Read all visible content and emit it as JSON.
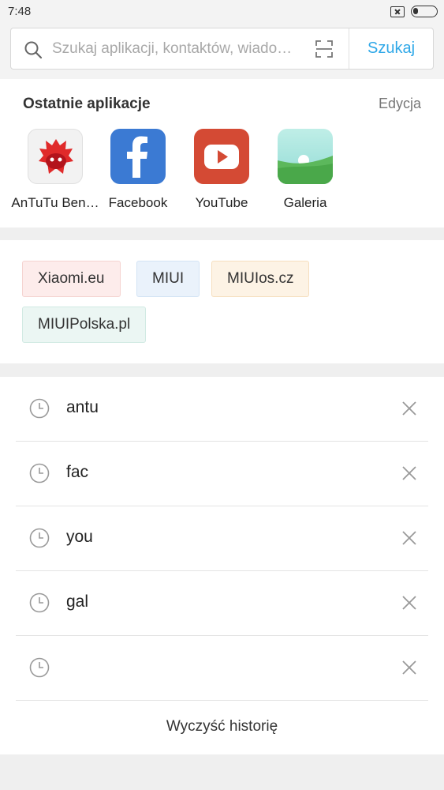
{
  "status_bar": {
    "time": "7:48"
  },
  "search": {
    "placeholder": "Szukaj aplikacji, kontaktów, wiado…",
    "button_label": "Szukaj"
  },
  "recent_apps": {
    "title": "Ostatnie aplikacje",
    "edit_label": "Edycja",
    "apps": [
      {
        "label": "AnTuTu Ben…",
        "icon": "antutu-icon"
      },
      {
        "label": "Facebook",
        "icon": "facebook-icon"
      },
      {
        "label": "YouTube",
        "icon": "youtube-icon"
      },
      {
        "label": "Galeria",
        "icon": "gallery-icon"
      }
    ]
  },
  "suggested_sites": [
    {
      "label": "Xiaomi.eu",
      "bg": "#fdeceb",
      "border": "#f5d3d0"
    },
    {
      "label": "MIUI",
      "bg": "#eaf2fb",
      "border": "#d3e3f4"
    },
    {
      "label": "MIUIos.cz",
      "bg": "#fdf3e5",
      "border": "#f6dfbf"
    },
    {
      "label": "MIUIPolska.pl",
      "bg": "#ebf6f3",
      "border": "#d1eae3"
    }
  ],
  "history": {
    "items": [
      "antu",
      "fac",
      "you",
      "gal",
      ""
    ],
    "clear_label": "Wyczyść historię"
  },
  "colors": {
    "accent": "#2fa8e8",
    "background": "#efefef"
  }
}
